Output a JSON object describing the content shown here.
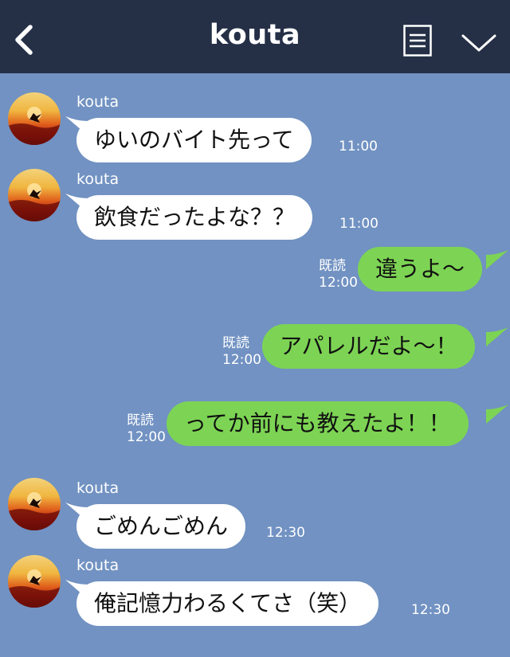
{
  "header": {
    "title": "kouta",
    "background": "#253047"
  },
  "colors": {
    "chat_background": "#7192c2",
    "incoming_bubble": "#ffffff",
    "outgoing_bubble": "#7dd454"
  },
  "icons": {
    "back": "chevron-left-icon",
    "menu": "list-icon",
    "more": "chevron-down-icon"
  },
  "messages": [
    {
      "direction": "in",
      "sender": "kouta",
      "text": "ゆいのバイト先って",
      "time": "11:00"
    },
    {
      "direction": "in",
      "sender": "kouta",
      "text": "飲食だったよな？？",
      "time": "11:00"
    },
    {
      "direction": "out",
      "read": "既読",
      "text": "違うよ〜",
      "time": "12:00"
    },
    {
      "direction": "out",
      "read": "既読",
      "text": "アパレルだよ〜！",
      "time": "12:00"
    },
    {
      "direction": "out",
      "read": "既読",
      "text": "ってか前にも教えたよ！！",
      "time": "12:00"
    },
    {
      "direction": "in",
      "sender": "kouta",
      "text": "ごめんごめん",
      "time": "12:30"
    },
    {
      "direction": "in",
      "sender": "kouta",
      "text": "俺記憶力わるくてさ（笑）",
      "time": "12:30"
    }
  ]
}
